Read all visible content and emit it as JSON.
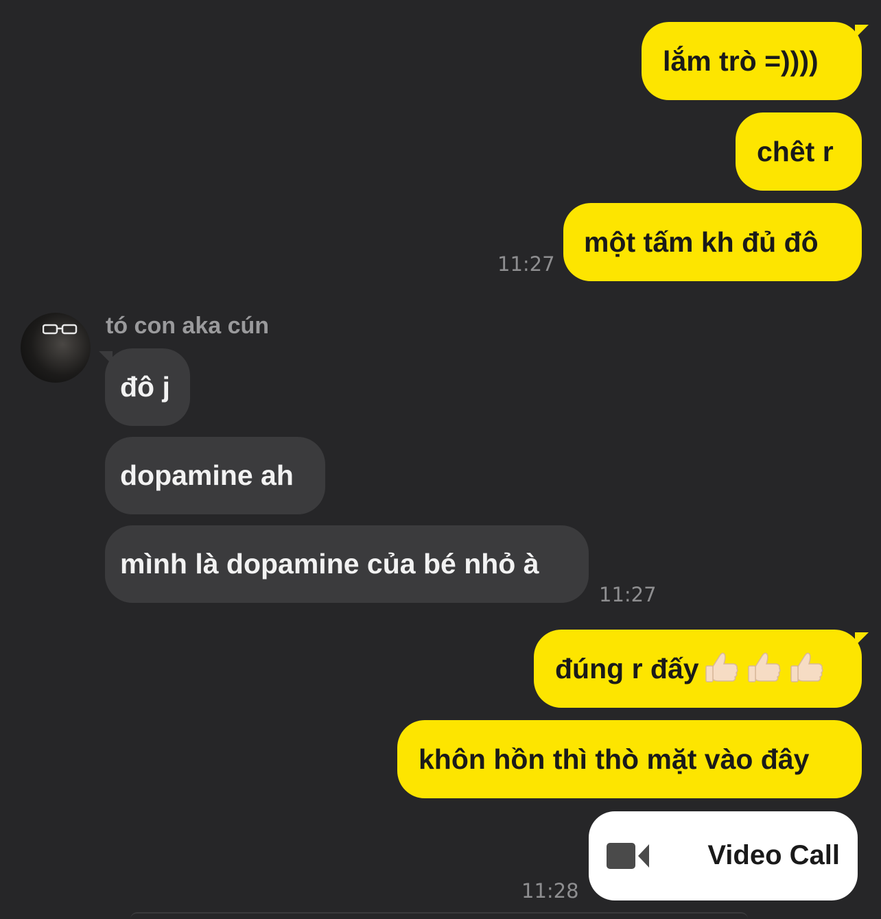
{
  "messages": {
    "out1": "lắm trò =))))",
    "out2": "chêt r",
    "out3": "một tấm kh đủ đô",
    "time1": "11:27",
    "sender_name": "tó con aka cún",
    "in1": "đô j",
    "in2": "dopamine ah",
    "in3": "mình là dopamine của bé nhỏ à",
    "time2": "11:27",
    "out4": "đúng r đấy",
    "out4_emoji": "👍🏻👍🏻👍🏻",
    "out5": "khôn hồn thì thò mặt vào đây",
    "time3": "11:28"
  },
  "video_call": {
    "label": "Video Call",
    "icon": "video-camera-icon"
  },
  "colors": {
    "background": "#262628",
    "outgoing_bubble": "#fde500",
    "incoming_bubble": "#3b3b3d",
    "timestamp": "#8e8e90"
  }
}
